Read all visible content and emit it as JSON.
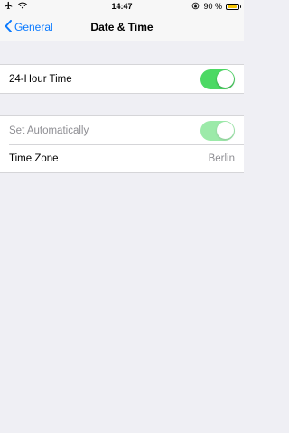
{
  "status_bar": {
    "time": "14:47",
    "battery_percent": "90 %",
    "battery_level": 0.9,
    "icons": [
      "airplane-icon",
      "wifi-icon",
      "orientation-lock-icon",
      "battery-icon"
    ]
  },
  "nav": {
    "back_label": "General",
    "title": "Date & Time"
  },
  "settings": {
    "hour24": {
      "label": "24-Hour Time",
      "on": true
    },
    "set_auto": {
      "label": "Set Automatically",
      "on": true,
      "enabled": false
    },
    "time_zone": {
      "label": "Time Zone",
      "value": "Berlin"
    }
  },
  "colors": {
    "accent": "#0a7aff",
    "toggle_on": "#4cd964",
    "background": "#efeff4",
    "secondary_text": "#8e8e93",
    "battery_fill": "#f5c400"
  }
}
